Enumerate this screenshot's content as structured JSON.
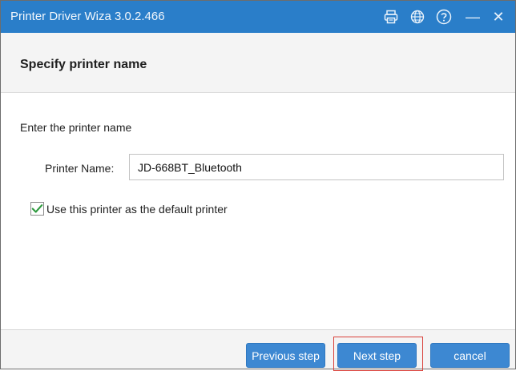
{
  "window": {
    "title": "Printer Driver Wiza  3.0.2.466",
    "controls": {
      "printer_icon": "printer-icon",
      "language_icon": "globe-icon",
      "help_icon": "help-icon",
      "minimize_glyph": "—",
      "close_glyph": "✕"
    }
  },
  "header": {
    "heading": "Specify printer name"
  },
  "main": {
    "instruction": "Enter the printer name",
    "printer_name_label": "Printer Name:",
    "printer_name_value": "JD-668BT_Bluetooth",
    "default_checkbox": {
      "checked": true,
      "label": "Use this printer as the default printer"
    }
  },
  "footer": {
    "previous_label": "Previous step",
    "next_label": "Next step",
    "cancel_label": "cancel"
  },
  "colors": {
    "titlebar": "#2a7ec9",
    "button": "#3d88d2",
    "checkmark": "#2e9a3e",
    "highlight": "#d9403a"
  }
}
